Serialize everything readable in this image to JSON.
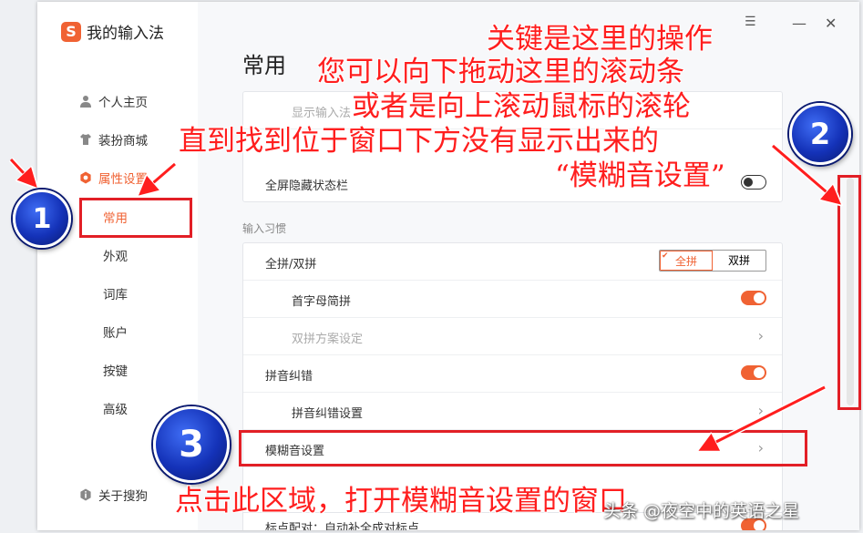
{
  "app": {
    "logo_letter": "S",
    "title": "我的输入法"
  },
  "sidebar": {
    "items": [
      {
        "label": "个人主页",
        "icon": "user-icon"
      },
      {
        "label": "装扮商城",
        "icon": "shirt-icon"
      },
      {
        "label": "属性设置",
        "icon": "settings-hexagon-icon"
      }
    ],
    "subitems": [
      "常用",
      "外观",
      "词库",
      "账户",
      "按键",
      "高级"
    ],
    "active_sub": "常用",
    "about": "关于搜狗"
  },
  "window": {
    "close": "✕",
    "minimize": "—",
    "menu": "☰"
  },
  "page": {
    "title": "常用"
  },
  "card1": {
    "rows": [
      {
        "label": "显示输入法",
        "state": "dim"
      },
      {
        "label": "全屏隐藏状态栏",
        "toggle": "off"
      }
    ]
  },
  "section": {
    "label": "输入习惯"
  },
  "card2": {
    "rows": [
      {
        "label": "全拼/双拼",
        "seg": [
          "全拼",
          "双拼"
        ]
      },
      {
        "label": "首字母简拼",
        "toggle": "on"
      },
      {
        "label": "双拼方案设定",
        "state": "dim",
        "chev": "›"
      },
      {
        "label": "拼音纠错",
        "toggle": "on"
      },
      {
        "label": "拼音纠错设置",
        "chev": "›"
      },
      {
        "label": "模糊音设置",
        "chev": "›"
      }
    ]
  },
  "bottom_row": {
    "label": "标点配对：自动补全成对标点"
  },
  "annotations": {
    "line1": "关键是这里的操作",
    "line2": "您可以向下拖动这里的滚动条",
    "line3": "或者是向上滚动鼠标的滚轮",
    "line4": "直到找到位于窗口下方没有显示出来的",
    "line5": "“模糊音设置”",
    "bottom": "点击此区域，打开模糊音设置的窗口",
    "badges": [
      "1",
      "2",
      "3"
    ]
  },
  "watermark": "头条 @夜空中的英语之星",
  "colors": {
    "accent": "#f06233",
    "annotation_red": "#ff1e1e",
    "badge_blue": "#1432b8"
  }
}
